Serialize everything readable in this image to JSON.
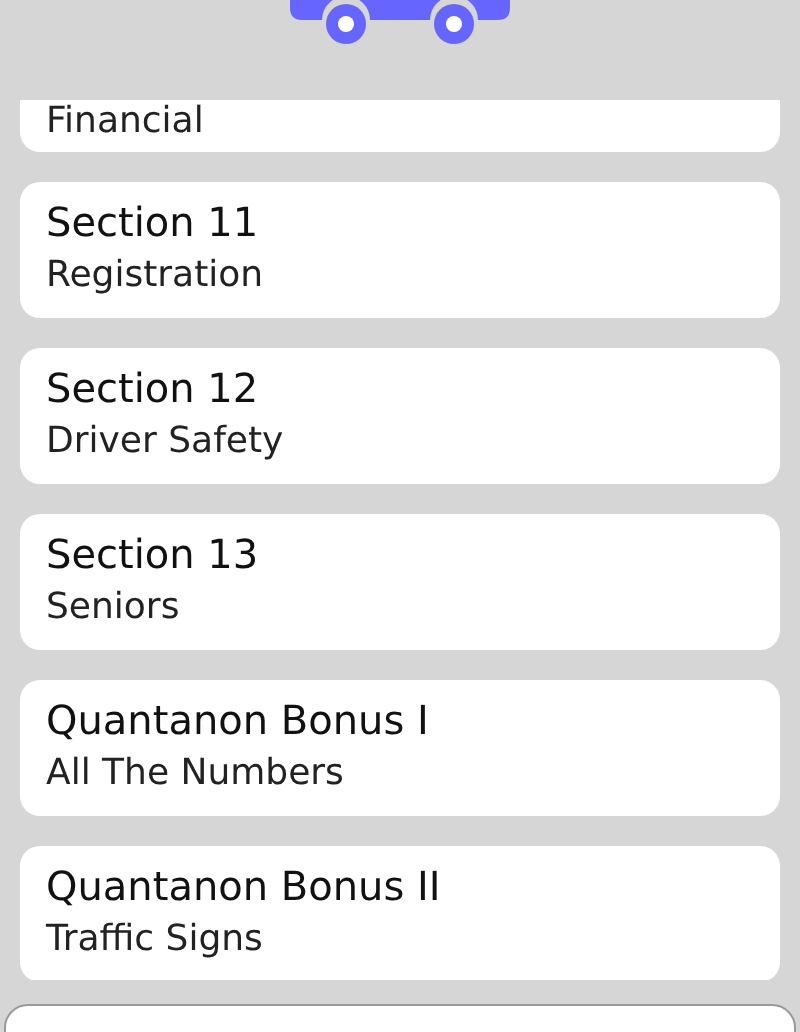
{
  "sections": [
    {
      "subtitle": "Financial"
    },
    {
      "title": "Section 11",
      "subtitle": "Registration"
    },
    {
      "title": "Section 12",
      "subtitle": "Driver Safety"
    },
    {
      "title": "Section 13",
      "subtitle": "Seniors"
    },
    {
      "title": "Quantanon Bonus I",
      "subtitle": "All The Numbers"
    },
    {
      "title": "Quantanon Bonus II",
      "subtitle": "Traffic Signs"
    }
  ]
}
